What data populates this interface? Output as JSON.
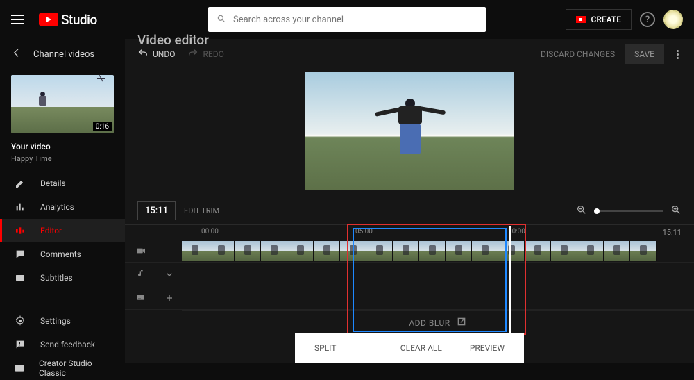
{
  "header": {
    "logo_text": "Studio",
    "search_placeholder": "Search across your channel",
    "create_label": "CREATE"
  },
  "sidebar": {
    "back_label": "Channel videos",
    "thumb_duration": "0:16",
    "your_video_label": "Your video",
    "video_title": "Happy Time",
    "items": [
      {
        "label": "Details"
      },
      {
        "label": "Analytics"
      },
      {
        "label": "Editor"
      },
      {
        "label": "Comments"
      },
      {
        "label": "Subtitles"
      }
    ],
    "footer": [
      {
        "label": "Settings"
      },
      {
        "label": "Send feedback"
      },
      {
        "label": "Creator Studio Classic"
      }
    ]
  },
  "editor": {
    "page_title": "Video editor",
    "undo_label": "UNDO",
    "redo_label": "REDO",
    "discard_label": "DISCARD CHANGES",
    "save_label": "SAVE",
    "current_time": "15:11",
    "edit_trim_label": "EDIT TRIM",
    "end_time": "15:11",
    "ruler": [
      "00:00",
      "05:00",
      "10:00"
    ],
    "add_blur_label": "ADD BLUR"
  },
  "bottom": {
    "split": "SPLIT",
    "clear_all": "CLEAR ALL",
    "preview": "PREVIEW"
  }
}
